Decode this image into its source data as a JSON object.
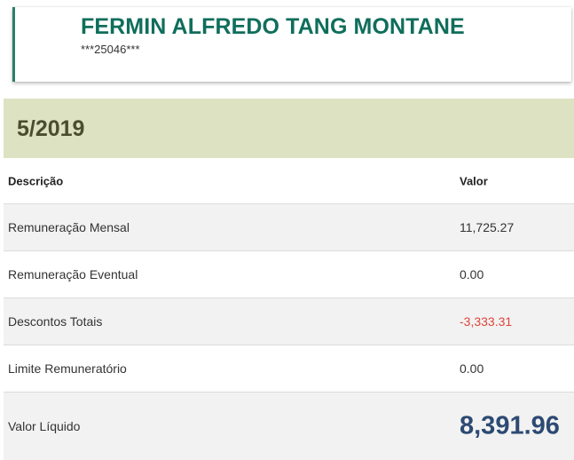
{
  "person": {
    "name": "FERMIN ALFREDO TANG MONTANE",
    "document_masked": "***25046***"
  },
  "period": {
    "label": "5/2019"
  },
  "table": {
    "header": {
      "description": "Descrição",
      "value": "Valor"
    },
    "rows": [
      {
        "description": "Remuneração Mensal",
        "value": "11,725.27"
      },
      {
        "description": "Remuneração Eventual",
        "value": "0.00"
      },
      {
        "description": "Descontos Totais",
        "value": "-3,333.31"
      },
      {
        "description": "Limite Remuneratório",
        "value": "0.00"
      }
    ],
    "total": {
      "description": "Valor Líquido",
      "value": "8,391.96"
    }
  },
  "colors": {
    "name_green": "#0f6e5b",
    "accent_border": "#2c7e6c",
    "period_bg": "#dde2c2",
    "period_text": "#4a4d2f",
    "negative_red": "#e0443b",
    "total_blue": "#2c4a73",
    "row_gray": "#f2f2f2"
  }
}
